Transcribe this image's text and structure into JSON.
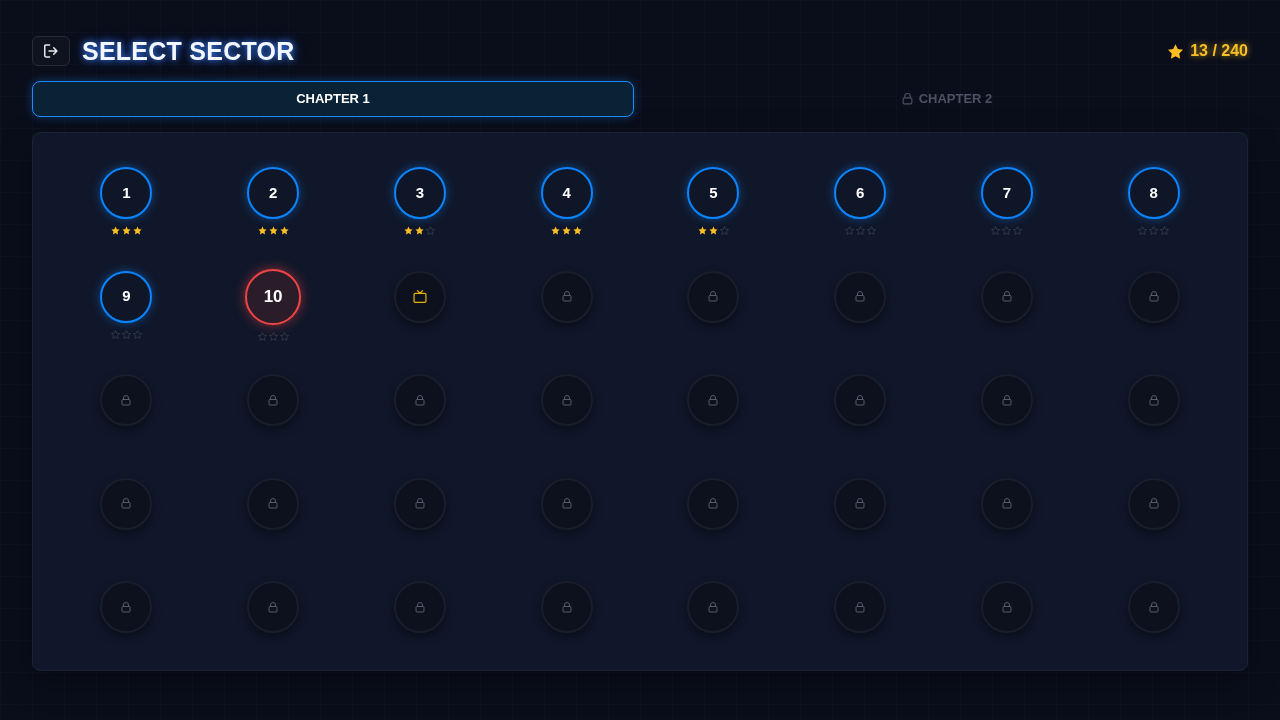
{
  "header": {
    "title": "SELECT SECTOR",
    "star_total": "13 / 240"
  },
  "tabs": [
    {
      "label": "CHAPTER 1",
      "selected": true,
      "locked": false
    },
    {
      "label": "CHAPTER 2",
      "selected": false,
      "locked": true
    }
  ],
  "levels": [
    {
      "kind": "completed",
      "label": "1",
      "stars": 3
    },
    {
      "kind": "completed",
      "label": "2",
      "stars": 3
    },
    {
      "kind": "completed",
      "label": "3",
      "stars": 2
    },
    {
      "kind": "completed",
      "label": "4",
      "stars": 3
    },
    {
      "kind": "completed",
      "label": "5",
      "stars": 2
    },
    {
      "kind": "completed",
      "label": "6",
      "stars": 0
    },
    {
      "kind": "completed",
      "label": "7",
      "stars": 0
    },
    {
      "kind": "completed",
      "label": "8",
      "stars": 0
    },
    {
      "kind": "completed",
      "label": "9",
      "stars": 0
    },
    {
      "kind": "current",
      "label": "10",
      "stars": 0
    },
    {
      "kind": "bonus"
    },
    {
      "kind": "locked"
    },
    {
      "kind": "locked"
    },
    {
      "kind": "locked"
    },
    {
      "kind": "locked"
    },
    {
      "kind": "locked"
    },
    {
      "kind": "locked"
    },
    {
      "kind": "locked"
    },
    {
      "kind": "locked"
    },
    {
      "kind": "locked"
    },
    {
      "kind": "locked"
    },
    {
      "kind": "locked"
    },
    {
      "kind": "locked"
    },
    {
      "kind": "locked"
    },
    {
      "kind": "locked"
    },
    {
      "kind": "locked"
    },
    {
      "kind": "locked"
    },
    {
      "kind": "locked"
    },
    {
      "kind": "locked"
    },
    {
      "kind": "locked"
    },
    {
      "kind": "locked"
    },
    {
      "kind": "locked"
    },
    {
      "kind": "locked"
    },
    {
      "kind": "locked"
    },
    {
      "kind": "locked"
    },
    {
      "kind": "locked"
    },
    {
      "kind": "locked"
    },
    {
      "kind": "locked"
    },
    {
      "kind": "locked"
    },
    {
      "kind": "locked"
    }
  ]
}
